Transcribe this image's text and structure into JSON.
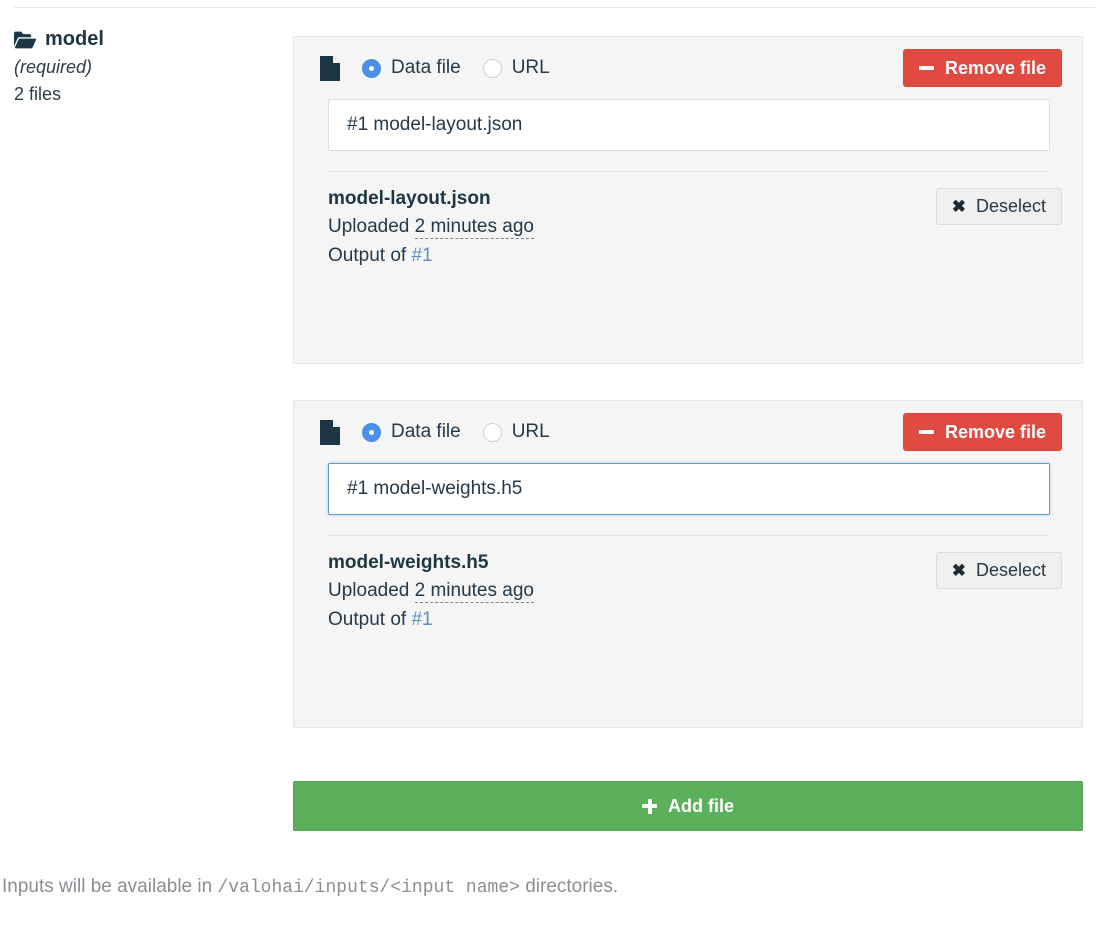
{
  "input_group": {
    "name": "model",
    "folder_icon": "folder-open-icon",
    "required_note": "(required)",
    "file_count": "2 files"
  },
  "cards": [
    {
      "doc_icon": "document-icon",
      "source_options": [
        {
          "label": "Data file",
          "selected": true
        },
        {
          "label": "URL",
          "selected": false
        }
      ],
      "remove_label": "Remove file",
      "remove_icon": "minus-icon",
      "input_value": "#1 model-layout.json",
      "input_placeholder": "",
      "focused": false,
      "detail": {
        "filename": "model-layout.json",
        "uploaded_prefix": "Uploaded",
        "uploaded_time": "2 minutes ago",
        "output_prefix": "Output of",
        "output_ref": "#1"
      },
      "deselect_label": "Deselect",
      "deselect_icon": "close-x-icon"
    },
    {
      "doc_icon": "document-icon",
      "source_options": [
        {
          "label": "Data file",
          "selected": true
        },
        {
          "label": "URL",
          "selected": false
        }
      ],
      "remove_label": "Remove file",
      "remove_icon": "minus-icon",
      "input_value": "#1 model-weights.h5",
      "input_placeholder": "",
      "focused": true,
      "detail": {
        "filename": "model-weights.h5",
        "uploaded_prefix": "Uploaded",
        "uploaded_time": "2 minutes ago",
        "output_prefix": "Output of",
        "output_ref": "#1"
      },
      "deselect_label": "Deselect",
      "deselect_icon": "close-x-icon"
    }
  ],
  "add_file": {
    "label": "Add file",
    "icon": "plus-icon"
  },
  "footer": {
    "text_before": "Inputs will be available in ",
    "path": "/valohai/inputs/<input name>",
    "text_after": " directories."
  },
  "colors": {
    "remove_red": "#e04a41",
    "add_green": "#5cb05c",
    "radio_blue": "#4a90e8",
    "link_blue": "#5b8fc9",
    "card_bg": "#f5f5f5",
    "focus_border": "#5b9bd5"
  }
}
